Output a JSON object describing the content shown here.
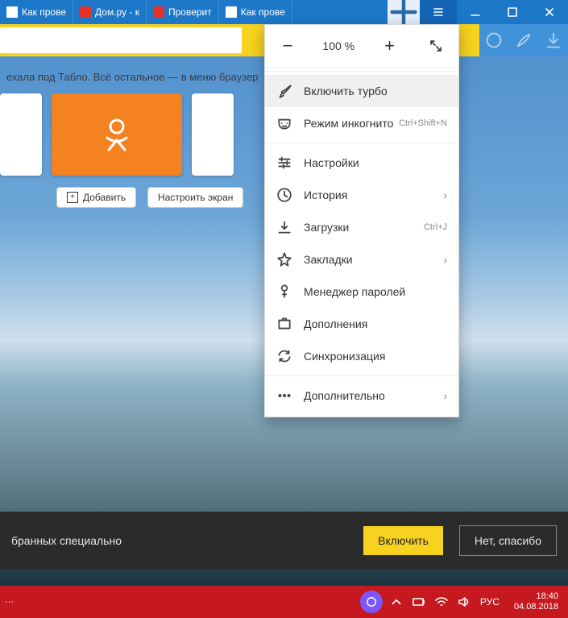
{
  "tabs": [
    {
      "label": "Как прове",
      "icon": "fav-k"
    },
    {
      "label": "Дом.ру - к",
      "icon": "fav-d"
    },
    {
      "label": "Проверит",
      "icon": "fav-p"
    },
    {
      "label": "Как прове",
      "icon": "fav-y"
    }
  ],
  "zoom": {
    "value": "100 %"
  },
  "hint_text": "ехала под Табло. Всё остальное — в меню браузер",
  "buttons": {
    "add": "Добавить",
    "configure": "Настроить экран"
  },
  "menu": {
    "turbo": "Включить турбо",
    "incognito": "Режим инкогнито",
    "incognito_short": "Ctrl+Shift+N",
    "settings": "Настройки",
    "history": "История",
    "downloads": "Загрузки",
    "downloads_short": "Ctrl+J",
    "bookmarks": "Закладки",
    "passwords": "Менеджер паролей",
    "addons": "Дополнения",
    "sync": "Синхронизация",
    "more": "Дополнительно"
  },
  "promo": {
    "text": "бранных специально",
    "enable": "Включить",
    "no": "Нет, спасибо"
  },
  "system": {
    "lang": "РУС",
    "time": "18:40",
    "date": "04.08.2018"
  }
}
